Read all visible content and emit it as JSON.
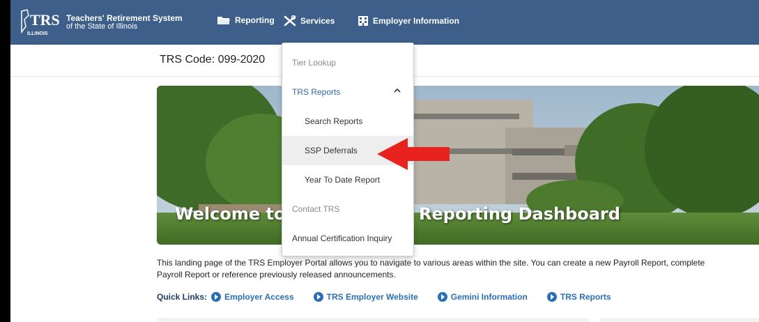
{
  "header": {
    "brand_line1": "Teachers' Retirement System",
    "brand_line2": "of the State of Illinois",
    "logo_text": "TRS",
    "logo_sub": "ILLINOIS",
    "nav": [
      {
        "label": "Reporting",
        "icon": "folder-icon"
      },
      {
        "label": "Services",
        "icon": "tools-icon"
      },
      {
        "label": "Employer Information",
        "icon": "building-icon"
      }
    ]
  },
  "trs_code": "TRS Code: 099-2020",
  "dropdown": {
    "items": [
      {
        "label": "Tier Lookup"
      },
      {
        "label": "TRS Reports",
        "expanded": true
      },
      {
        "label": "Search Reports"
      },
      {
        "label": "SSP Deferrals"
      },
      {
        "label": "Year To Date Report"
      },
      {
        "label": "Contact TRS"
      },
      {
        "label": "Annual Certification Inquiry"
      }
    ]
  },
  "banner": {
    "title_left": "Welcome to",
    "title_right": "Reporting Dashboard"
  },
  "intro": {
    "line1": "This landing page of the TRS Employer Portal allows you to navigate to various areas within the site. You can create a new Payroll Report, complete",
    "line2": "Payroll Report or reference previously released announcements."
  },
  "quick_links": {
    "label": "Quick Links:",
    "links": [
      "Employer Access",
      "TRS Employer Website",
      "Gemini Information",
      "TRS Reports"
    ]
  },
  "colors": {
    "header_bg": "#3d5f8a",
    "link_blue": "#2a6fb5",
    "arrow_red": "#e8231f"
  }
}
